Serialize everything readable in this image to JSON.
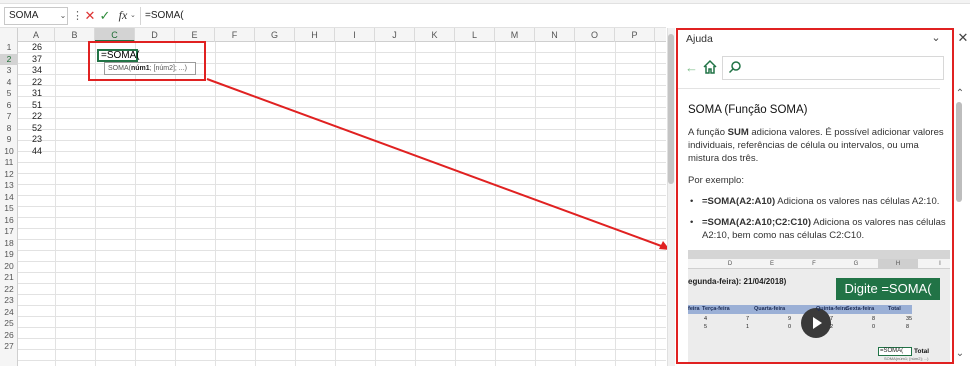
{
  "formula_bar": {
    "name_box": "SOMA",
    "name_box_caret": "⌄",
    "more_icon": "⋮",
    "cancel_glyph": "✕",
    "enter_glyph": "✓",
    "fx_label": "fx",
    "fx_caret": "⌄",
    "formula": "=SOMA("
  },
  "sheet": {
    "columns": [
      "A",
      "B",
      "C",
      "D",
      "E",
      "F",
      "G",
      "H",
      "I",
      "J",
      "K",
      "L",
      "M",
      "N",
      "O",
      "P"
    ],
    "selected_column": "C",
    "rows": [
      "1",
      "2",
      "3",
      "4",
      "5",
      "6",
      "7",
      "8",
      "9",
      "10",
      "11",
      "12",
      "13",
      "14",
      "15",
      "16",
      "17",
      "18",
      "19",
      "20",
      "21",
      "22",
      "23",
      "24",
      "25",
      "26",
      "27"
    ],
    "selected_row": "2",
    "column_a_values": [
      "26",
      "37",
      "34",
      "22",
      "31",
      "51",
      "22",
      "52",
      "23",
      "44"
    ],
    "active_cell_text": "=SOMA(",
    "tooltip": {
      "prefix": "SOMA(",
      "arg1": "núm1",
      "rest": "; [núm2]; ...)"
    }
  },
  "help": {
    "title": "Ajuda",
    "collapse_glyph": "⌄",
    "close_glyph": "✕",
    "back_glyph": "←",
    "article_title": "SOMA (Função SOMA)",
    "intro_before": "A função ",
    "intro_bold": "SUM",
    "intro_after": " adiciona valores. É possível adicionar valores individuais, referências de célula ou intervalos, ou uma mistura dos três.",
    "example_label": "Por exemplo:",
    "bullets": [
      {
        "code": "=SOMA(A2:A10)",
        "text": " Adiciona os valores nas células A2:10."
      },
      {
        "code": "=SOMA(A2:A10;C2:C10)",
        "text": " Adiciona os valores nas células A2:10, bem como nas células C2:C10."
      }
    ],
    "scroll_up_glyph": "⌃",
    "scroll_down_glyph": "⌄",
    "video": {
      "columns": [
        "D",
        "E",
        "F",
        "G",
        "H",
        "I"
      ],
      "selected_column": "H",
      "heading": "egunda-feira): 21/04/2018)",
      "badge": "Digite =SOMA(",
      "table_headers": [
        "feira",
        "Terça-feira",
        "Quarta-feira",
        "Quinta-feira",
        "Sexta-feira",
        "Total"
      ],
      "row1": [
        "4",
        "7",
        "9",
        "7",
        "8",
        "35"
      ],
      "row2": [
        "5",
        "1",
        "0",
        "2",
        "0",
        "8"
      ],
      "formula": "=SOMA(",
      "total_label": "Total",
      "hint": "SOMA(núm1; [núm2]; ...)"
    }
  },
  "colors": {
    "annotation_red": "#e02121",
    "excel_green": "#217346"
  }
}
